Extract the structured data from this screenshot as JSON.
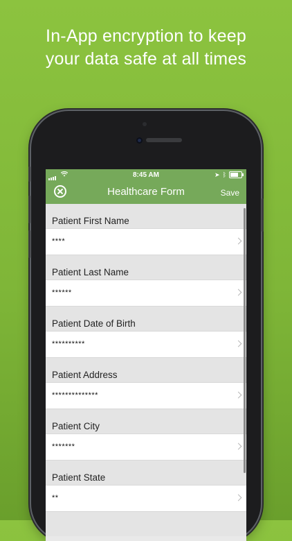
{
  "promo": {
    "line1": "In-App encryption to keep",
    "line2": "your data safe at all times"
  },
  "status_bar": {
    "time": "8:45 AM"
  },
  "nav": {
    "title": "Healthcare Form",
    "save_label": "Save",
    "close_icon": "close-circle-icon"
  },
  "colors": {
    "background": "#8cc33f",
    "nav_bar": "#76a95a"
  },
  "fields": [
    {
      "label": "Patient First Name",
      "value": "****"
    },
    {
      "label": "Patient Last Name",
      "value": "******"
    },
    {
      "label": "Patient Date of Birth",
      "value": "**********"
    },
    {
      "label": "Patient Address",
      "value": "**************"
    },
    {
      "label": "Patient City",
      "value": "*******"
    },
    {
      "label": "Patient State",
      "value": "**"
    }
  ]
}
